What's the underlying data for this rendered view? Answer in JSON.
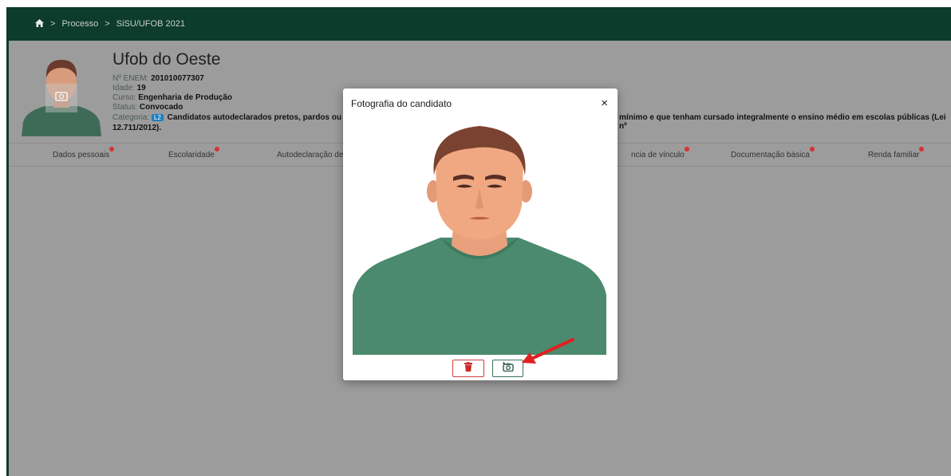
{
  "breadcrumb": {
    "home_icon": "home-icon",
    "items": [
      "Processo",
      "SiSU/UFOB 2021"
    ],
    "separator": ">"
  },
  "candidate": {
    "name": "Ufob do Oeste",
    "enem_label": "Nº ENEM:",
    "enem_value": "201010077307",
    "age_label": "Idade:",
    "age_value": "19",
    "course_label": "Curso:",
    "course_value": "Engenharia de Produção",
    "status_label": "Status:",
    "status_value": "Convocado",
    "category_label": "Categoria:",
    "category_badge": "L2",
    "category_text_left": "Candidatos autodeclarados pretos, pardos ou ind",
    "category_text_right": "mínimo e que tenham cursado integralmente o ensino médio em escolas públicas (Lei nº",
    "category_text_line2": "12.711/2012)."
  },
  "tabs": [
    {
      "label": "Dados pessoais"
    },
    {
      "label": "Escolaridade"
    },
    {
      "label": "Autodeclaração de de"
    },
    {
      "label": "ncia de vínculo"
    },
    {
      "label": "Documentação básica"
    },
    {
      "label": "Renda familiar"
    }
  ],
  "modal": {
    "title": "Fotografia do candidato",
    "close_glyph": "×",
    "delete_icon": "trash-icon",
    "add_photo_icon": "add-photo-camera-icon"
  },
  "colors": {
    "topbar": "#0d3b2c",
    "overlay": "#9c9c9c",
    "status_dot": "#d73232",
    "delete_accent": "#c94040",
    "photo_accent": "#3b6f5c",
    "arrow": "#e02020"
  }
}
